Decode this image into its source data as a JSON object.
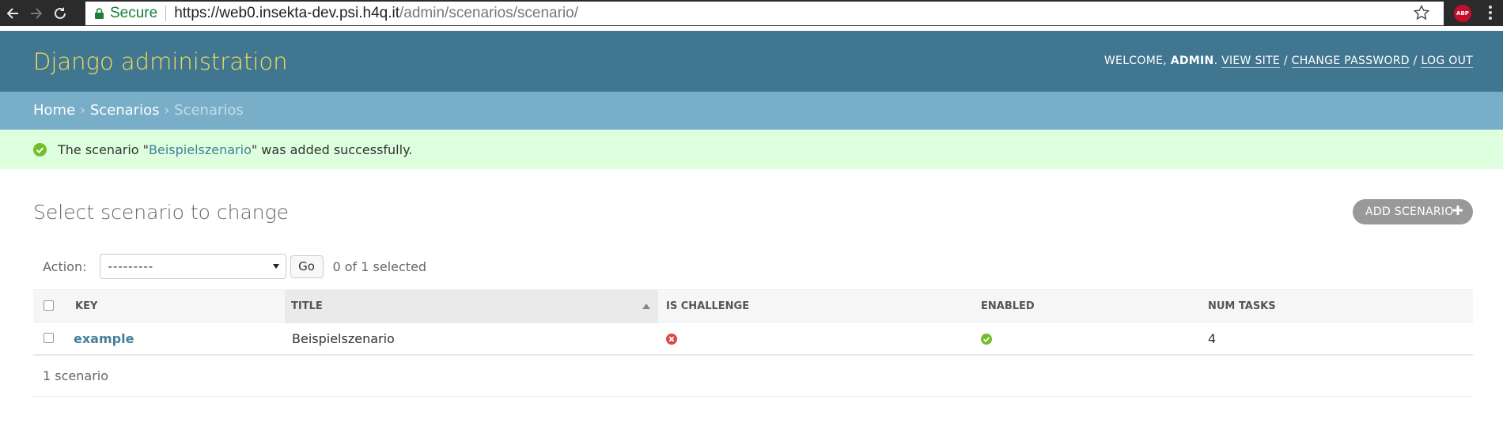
{
  "browser": {
    "secure_label": "Secure",
    "url_host": "https://web0.insekta-dev.psi.h4q.it",
    "url_path": "/admin/scenarios/scenario/",
    "extension_label": "ABP"
  },
  "header": {
    "site_name": "Django administration",
    "welcome": "WELCOME,",
    "username": "ADMIN",
    "period": ".",
    "view_site": "VIEW SITE",
    "change_password": "CHANGE PASSWORD",
    "log_out": "LOG OUT",
    "separator": "/"
  },
  "breadcrumbs": {
    "home": "Home",
    "app": "Scenarios",
    "current": "Scenarios",
    "separator": "›"
  },
  "message": {
    "prefix": "The scenario \"",
    "link": "Beispielszenario",
    "suffix": "\" was added successfully."
  },
  "content": {
    "title": "Select scenario to change",
    "add_button": "ADD SCENARIO"
  },
  "actions": {
    "label": "Action:",
    "selected_option": "---------",
    "go_label": "Go",
    "selection_count": "0 of 1 selected"
  },
  "table": {
    "columns": [
      "KEY",
      "TITLE",
      "IS CHALLENGE",
      "ENABLED",
      "NUM TASKS"
    ],
    "rows": [
      {
        "key": "example",
        "title": "Beispielszenario",
        "is_challenge": "no-icon",
        "enabled": "yes-icon",
        "num_tasks": "4"
      }
    ],
    "footer": "1 scenario"
  },
  "colors": {
    "header_bg": "#417690",
    "branding": "#f5dd5d",
    "breadcrumb_bg": "#79aec8",
    "message_bg": "#ddffdd",
    "link": "#447e9b",
    "success": "#70bf2b",
    "error": "#dd4646"
  }
}
